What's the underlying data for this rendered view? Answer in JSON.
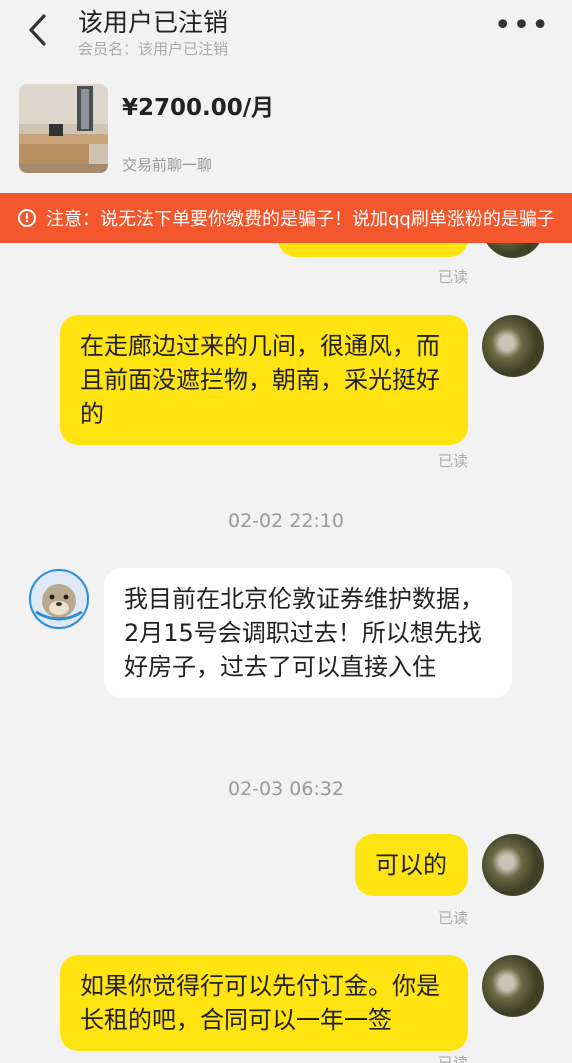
{
  "header": {
    "title": "该用户已注销",
    "subtitle": "会员名：该用户已注销",
    "back_icon": "chevron-left-icon",
    "more_icon": "more-horizontal-icon",
    "more_label": "•••"
  },
  "product": {
    "price": "¥2700.00/月",
    "chat_label": "交易前聊一聊"
  },
  "notice": {
    "icon": "!",
    "text": "注意：说无法下单要你缴费的是骗子！说加qq刷单涨粉的是骗子"
  },
  "messages": [
    {
      "side": "me",
      "text": "",
      "status": "已读"
    },
    {
      "side": "me",
      "text": "在走廊边过来的几间，很通风，而且前面没遮拦物，朝南，采光挺好的",
      "status": "已读"
    },
    {
      "time": "02-02 22:10"
    },
    {
      "side": "them",
      "text": "我目前在北京伦敦证券维护数据，2月15号会调职过去！所以想先找好房子，过去了可以直接入住"
    },
    {
      "time": "02-03 06:32"
    },
    {
      "side": "me",
      "text": "可以的",
      "status": "已读"
    },
    {
      "side": "me",
      "text": "如果你觉得行可以先付订金。你是长租的吧，合同可以一年一签",
      "status": "已读"
    }
  ],
  "colors": {
    "my_bubble": "#ffe411",
    "their_bubble": "#ffffff",
    "notice_bg": "#f4572e",
    "page_bg": "#f2f2f2"
  }
}
